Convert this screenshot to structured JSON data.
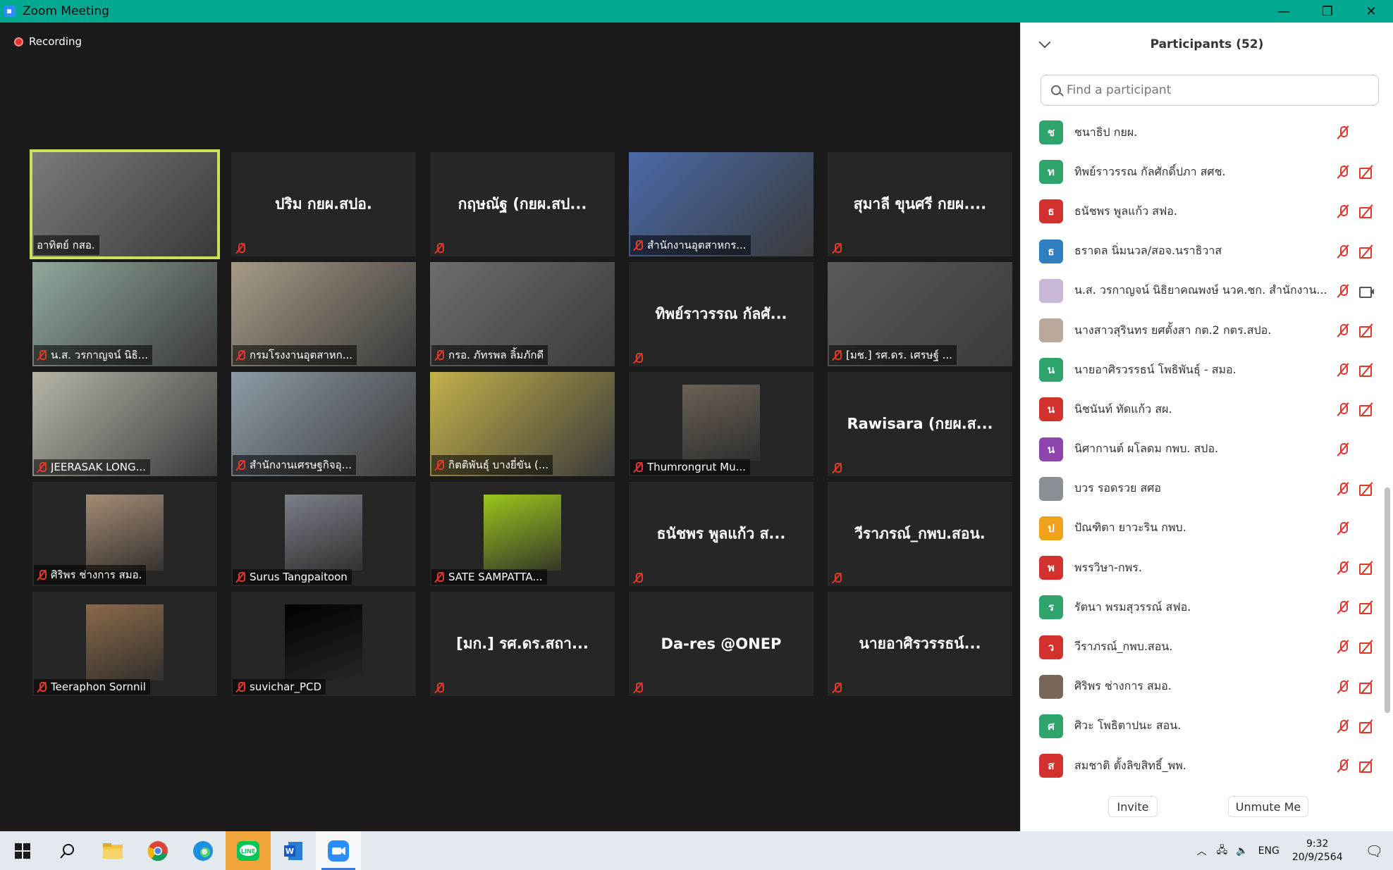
{
  "window": {
    "title": "Zoom Meeting"
  },
  "meeting": {
    "recording_label": "Recording",
    "tiles": [
      {
        "name": "อาทิตย์ กสอ.",
        "video": true,
        "active": true,
        "muted": false,
        "avatar_color": "#7a7a76"
      },
      {
        "name": "ปริม กยผ.สปอ.",
        "video": false,
        "muted": true
      },
      {
        "name": "กฤษณัฐ (กยผ.สป...",
        "video": false,
        "muted": true
      },
      {
        "name": "สำนักงานอุตสาหกร...",
        "video": true,
        "muted": true,
        "avatar_color": "#4a6aa8"
      },
      {
        "name": "สุมาลี ขุนศรี กยผ....",
        "video": false,
        "muted": true
      },
      {
        "name": "น.ส. วรกาญจน์ นิธิ...",
        "video": true,
        "muted": true,
        "avatar_color": "#8fa79a"
      },
      {
        "name": "กรมโรงงานอุตสาหก...",
        "video": true,
        "muted": true,
        "avatar_color": "#a59a86"
      },
      {
        "name": "กรอ. ภัทรพล ลิ้มภักดี",
        "video": true,
        "muted": true,
        "avatar_color": "#6d6d6d"
      },
      {
        "name": "ทิพย์ราวรรณ กัลศั...",
        "video": false,
        "muted": true
      },
      {
        "name": "[มช.] รศ.ดร. เศรษฐ์ ...",
        "video": true,
        "muted": true,
        "avatar_color": "#5a5a5a"
      },
      {
        "name": "JEERASAK LONG...",
        "video": true,
        "muted": true,
        "avatar_color": "#b6b3a6"
      },
      {
        "name": "สำนักงานเศรษฐกิจอุ...",
        "video": true,
        "muted": true,
        "avatar_color": "#8c9aa4"
      },
      {
        "name": "กิตติพันธุ์ บางยี่ขัน (...",
        "video": true,
        "muted": true,
        "avatar_color": "#c2b04a"
      },
      {
        "name": "Thumrongrut Mu...",
        "video": false,
        "photo": true,
        "muted": true,
        "avatar_color": "#6b6156"
      },
      {
        "name": "Rawisara (กยผ.ส...",
        "video": false,
        "muted": true
      },
      {
        "name": "ศิริพร ช่างการ สมอ.",
        "video": false,
        "photo": true,
        "muted": true,
        "avatar_color": "#a58b74"
      },
      {
        "name": "Surus Tangpaitoon",
        "video": false,
        "photo": true,
        "muted": true,
        "avatar_color": "#7b7f88"
      },
      {
        "name": "SATE SAMPATTA...",
        "video": false,
        "photo": true,
        "muted": true,
        "avatar_color": "#9bc51c"
      },
      {
        "name": "ธนัชพร พูลแก้ว ส...",
        "video": false,
        "muted": true
      },
      {
        "name": "วีราภรณ์_กพบ.สอน.",
        "video": false,
        "muted": true
      },
      {
        "name": "Teeraphon Sornnil",
        "video": false,
        "photo": true,
        "muted": true,
        "avatar_color": "#8a6a4a"
      },
      {
        "name": "suvichar_PCD",
        "video": false,
        "photo": true,
        "muted": true,
        "avatar_color": "#000000"
      },
      {
        "name": "[มก.] รศ.ดร.สถา...",
        "video": false,
        "muted": true
      },
      {
        "name": "Da-res @ONEP",
        "video": false,
        "muted": true
      },
      {
        "name": "นายอาศิรวรรธน์...",
        "video": false,
        "muted": true
      }
    ]
  },
  "participants": {
    "title": "Participants (52)",
    "search_placeholder": "Find a participant",
    "list": [
      {
        "initial": "ช",
        "name": "ชนาธิป กยผ.",
        "color": "#2ea36b",
        "cam": "none"
      },
      {
        "initial": "ท",
        "name": "ทิพย์ราวรรณ กัลศักดิ์ปภา สศช.",
        "color": "#2ea36b",
        "cam": "off"
      },
      {
        "initial": "ธ",
        "name": "ธนัชพร พูลแก้ว สฟอ.",
        "color": "#d2322d",
        "cam": "off"
      },
      {
        "initial": "ธ",
        "name": "ธราดล นิ่มนวล/สอจ.นราธิวาส",
        "color": "#2f7fc1",
        "cam": "off"
      },
      {
        "initial": "",
        "name": "น.ส. วรกาญจน์ นิธิยาคณพงษ์ นวค.ชก. สำนักงาน...",
        "color": "#c9b7d8",
        "cam": "on"
      },
      {
        "initial": "",
        "name": "นางสาวสุรินทร ยศตั้งสา กต.2 กตร.สปอ.",
        "color": "#b9a99a",
        "cam": "off"
      },
      {
        "initial": "น",
        "name": "นายอาศิรวรรธน์ โพธิพันธุ์ - สมอ.",
        "color": "#2ea36b",
        "cam": "off"
      },
      {
        "initial": "น",
        "name": "นิชนันท์ ทัดแก้ว สผ.",
        "color": "#d2322d",
        "cam": "off"
      },
      {
        "initial": "น",
        "name": "นิศากานต์ ผโลดม กพบ. สปอ.",
        "color": "#8e44ad",
        "cam": "none"
      },
      {
        "initial": "",
        "name": "บวร รอดรวย สศอ",
        "color": "#8b8f96",
        "cam": "off"
      },
      {
        "initial": "ป",
        "name": "ปัณฑิตา ยาวะริน กพบ.",
        "color": "#f0a21a",
        "cam": "none"
      },
      {
        "initial": "พ",
        "name": "พรรวิษา-กพร.",
        "color": "#d2322d",
        "cam": "off"
      },
      {
        "initial": "ร",
        "name": "รัตนา พรมสุวรรณ์ สฟอ.",
        "color": "#2ea36b",
        "cam": "off"
      },
      {
        "initial": "ว",
        "name": "วีราภรณ์_กพบ.สอน.",
        "color": "#d2322d",
        "cam": "off"
      },
      {
        "initial": "",
        "name": "ศิริพร ช่างการ สมอ.",
        "color": "#7a6656",
        "cam": "off"
      },
      {
        "initial": "ศ",
        "name": "ศิวะ โพธิตาปนะ สอน.",
        "color": "#2ea36b",
        "cam": "off"
      },
      {
        "initial": "ส",
        "name": "สมชาติ ตั้งลิขสิทธิ์_พพ.",
        "color": "#d2322d",
        "cam": "off"
      }
    ],
    "invite_label": "Invite",
    "unmute_label": "Unmute Me"
  },
  "taskbar": {
    "apps": [
      "windows-start",
      "search",
      "file-explorer",
      "chrome",
      "edge",
      "line",
      "word",
      "zoom"
    ],
    "language": "ENG",
    "time": "9:32",
    "date": "20/9/2564"
  }
}
